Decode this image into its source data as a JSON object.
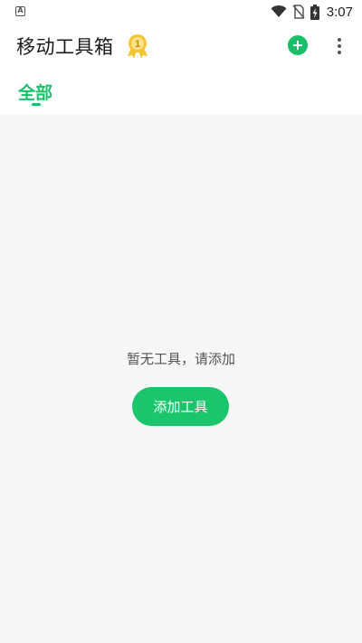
{
  "status_bar": {
    "app_icon_glyph": "A",
    "time": "3:07",
    "icons": [
      "wifi-icon",
      "no-sim-icon",
      "battery-charging-icon"
    ]
  },
  "app_bar": {
    "title": "移动工具箱",
    "badge_number": "1",
    "add_icon": "plus-circle-icon",
    "more_icon": "more-vert-icon"
  },
  "tabs": [
    {
      "label": "全部",
      "selected": true
    }
  ],
  "empty_state": {
    "message": "暂无工具，请添加",
    "button_label": "添加工具"
  },
  "colors": {
    "accent": "#19c06a",
    "background": "#f7f7f7",
    "badge_gold": "#f5c431"
  }
}
